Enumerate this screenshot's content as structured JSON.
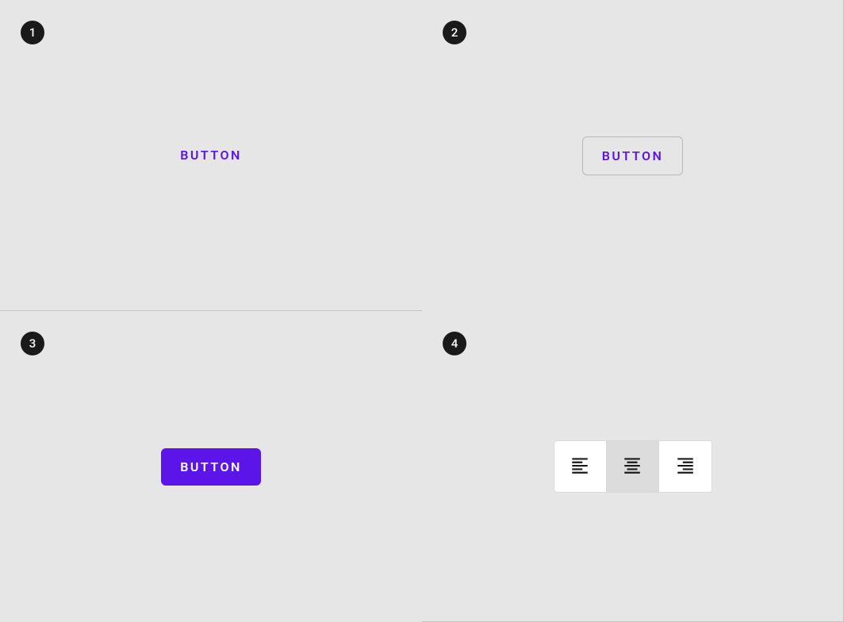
{
  "quadrants": {
    "q1": {
      "badge": "1",
      "button_label": "BUTTON"
    },
    "q2": {
      "badge": "2",
      "button_label": "BUTTON"
    },
    "q3": {
      "badge": "3",
      "button_label": "BUTTON"
    },
    "q4": {
      "badge": "4",
      "toggle": {
        "options": [
          {
            "name": "align-left",
            "selected": false
          },
          {
            "name": "align-center",
            "selected": true
          },
          {
            "name": "align-right",
            "selected": false
          }
        ]
      }
    }
  },
  "colors": {
    "primary": "#5b15e8",
    "background": "#e6e6e6",
    "badge": "#1a1a1a"
  }
}
